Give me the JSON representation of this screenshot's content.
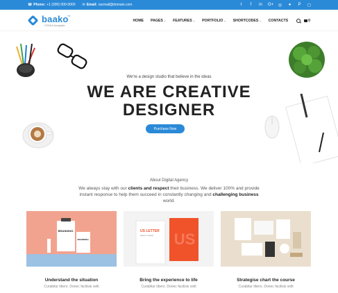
{
  "topbar": {
    "phone_label": "Phone:",
    "phone_value": "+1 (000) 000-0000",
    "email_label": "Email:",
    "email_value": "ourmail@domain.com",
    "socials": [
      "twitter-icon",
      "facebook-icon",
      "linkedin-icon",
      "googleplus-icon",
      "dribbble-icon",
      "github-icon",
      "pinterest-icon",
      "instagram-icon"
    ]
  },
  "header": {
    "logo_name": "baako",
    "logo_tm": "TM",
    "logo_sub": "HTML5 template",
    "nav": [
      {
        "label": "HOME",
        "caret": false
      },
      {
        "label": "PAGES",
        "caret": true
      },
      {
        "label": "FEATURES",
        "caret": true
      },
      {
        "label": "PORTFOLIO",
        "caret": true
      },
      {
        "label": "SHORTCODES",
        "caret": true
      },
      {
        "label": "CONTACTS",
        "caret": false
      }
    ],
    "cart_count": "0"
  },
  "hero": {
    "tagline": "We're a design studio that believe in the ideas",
    "headline_line1": "WE ARE CREATIVE",
    "headline_line2": "DESIGNER",
    "cta": "Purchase Now"
  },
  "about": {
    "kicker": "About Digital Agency",
    "p1": "We always stay with our ",
    "b1": "clients and respect",
    "p2": " their business. We deliver 100% and provide instant response to help them succeed in constantly changing and ",
    "b2": "challenging business",
    "p3": " world."
  },
  "cards": [
    {
      "title": "Understand the situation",
      "desc": "Curabitur libero. Donec facilisis velit",
      "img_text": "BRANDING.",
      "img_sub": "Showcase Your Powerful Visual Designs Here"
    },
    {
      "title": "Bring the experience to life",
      "desc": "Curabitur libero. Donec facilisis velit",
      "img_text": "US LETTER",
      "img_sub": "paper mockup"
    },
    {
      "title": "Strategise chart the course",
      "desc": "Curabitur libero. Donec facilisis velit",
      "img_text": "",
      "img_sub": ""
    }
  ],
  "colors": {
    "accent": "#2b8ad8",
    "card1_bg": "#f2a38f",
    "card2_accent": "#f0532a",
    "card3_bg": "#eadfce"
  }
}
